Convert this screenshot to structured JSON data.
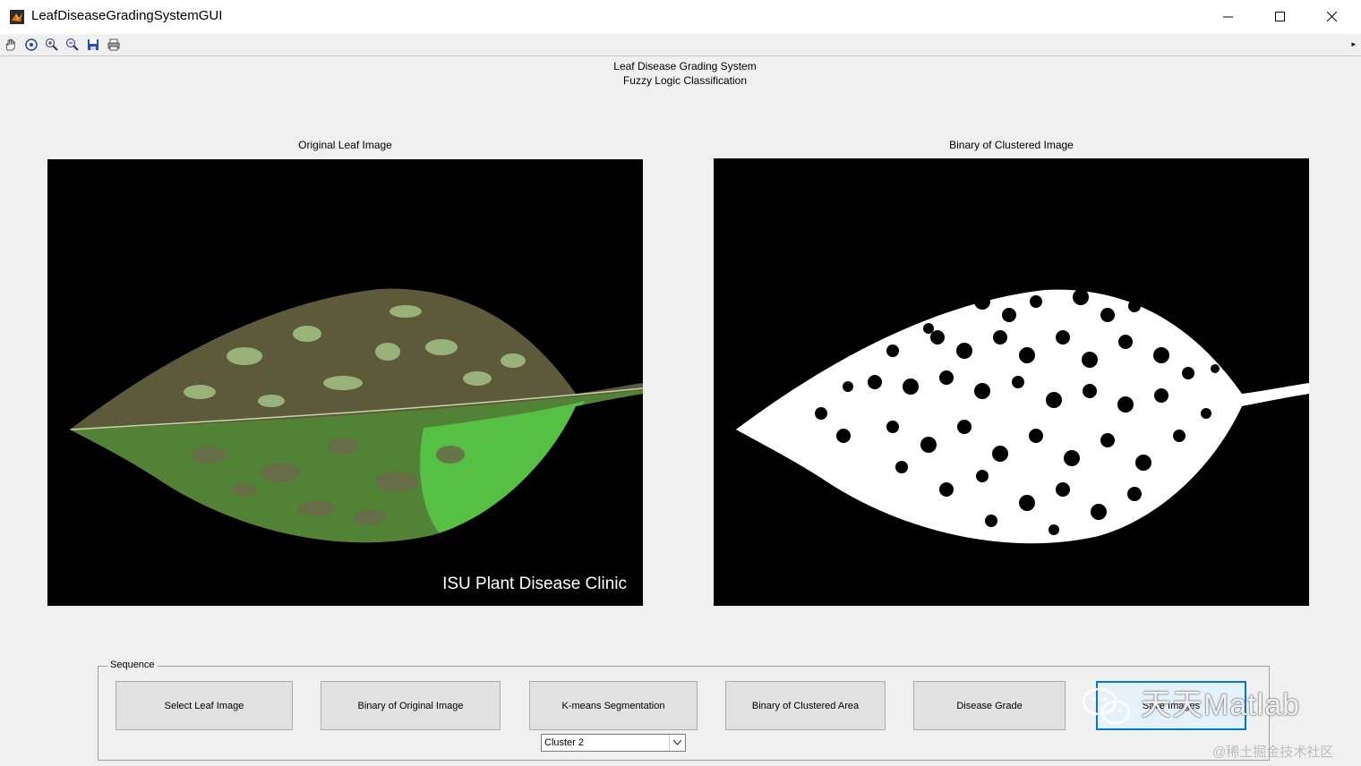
{
  "window": {
    "title": "LeafDiseaseGradingSystemGUI"
  },
  "toolbar": {
    "tools": [
      "hand-icon",
      "rotate-icon",
      "zoom-in-icon",
      "zoom-out-icon",
      "save-icon",
      "print-icon"
    ]
  },
  "header": {
    "title": "Leaf Disease Grading System",
    "subtitle": "Fuzzy Logic Classification"
  },
  "left_axes": {
    "title": "Original Leaf Image",
    "image_watermark": "ISU Plant Disease Clinic"
  },
  "right_axes": {
    "title": "Binary of Clustered Image"
  },
  "sequence": {
    "label": "Sequence",
    "buttons": [
      "Select Leaf Image",
      "Binary of Original Image",
      "K-means Segmentation",
      "Binary of Clustered Area",
      "Disease Grade",
      "Save Images"
    ],
    "cluster_select": {
      "value": "Cluster 2"
    }
  },
  "overlay": {
    "brand": "天天Matlab",
    "credit": "@稀土掘金技术社区"
  },
  "colors": {
    "leaf_dark": "#5a5a3a",
    "leaf_green": "#55c043",
    "background": "#000000",
    "binary_fg": "#ffffff",
    "focus_border": "#0078d7"
  }
}
